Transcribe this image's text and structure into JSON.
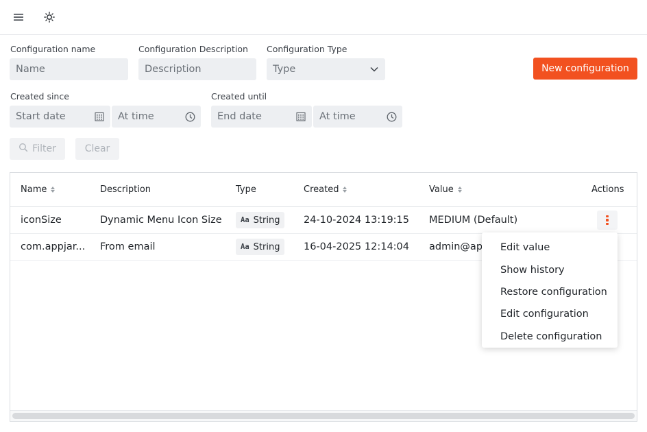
{
  "topbar": {
    "menu_icon": "hamburger-menu-icon",
    "theme_icon": "sun-icon"
  },
  "filters": {
    "name": {
      "label": "Configuration name",
      "placeholder": "Name"
    },
    "description": {
      "label": "Configuration Description",
      "placeholder": "Description"
    },
    "type": {
      "label": "Configuration Type",
      "placeholder": "Type"
    },
    "created_since": {
      "label": "Created since",
      "date_placeholder": "Start date",
      "time_placeholder": "At time"
    },
    "created_until": {
      "label": "Created until",
      "date_placeholder": "End date",
      "time_placeholder": "At time"
    },
    "filter_label": "Filter",
    "clear_label": "Clear"
  },
  "new_configuration_label": "New configuration",
  "table": {
    "headers": {
      "name": "Name",
      "description": "Description",
      "type": "Type",
      "created": "Created",
      "value": "Value",
      "actions": "Actions"
    },
    "rows": [
      {
        "name": "iconSize",
        "description": "Dynamic Menu Icon Size",
        "type_icon": "Aa",
        "type": "String",
        "created": "24-10-2024 13:19:15",
        "value": "MEDIUM (Default)"
      },
      {
        "name": "com.appjar...",
        "description": "From email",
        "type_icon": "Aa",
        "type": "String",
        "created": "16-04-2025 12:14:04",
        "value": "admin@app"
      }
    ]
  },
  "action_menu": {
    "items": [
      "Edit value",
      "Show history",
      "Restore configuration",
      "Edit configuration",
      "Delete configuration"
    ]
  },
  "colors": {
    "accent": "#f25120",
    "field_bg": "#edeff2"
  }
}
